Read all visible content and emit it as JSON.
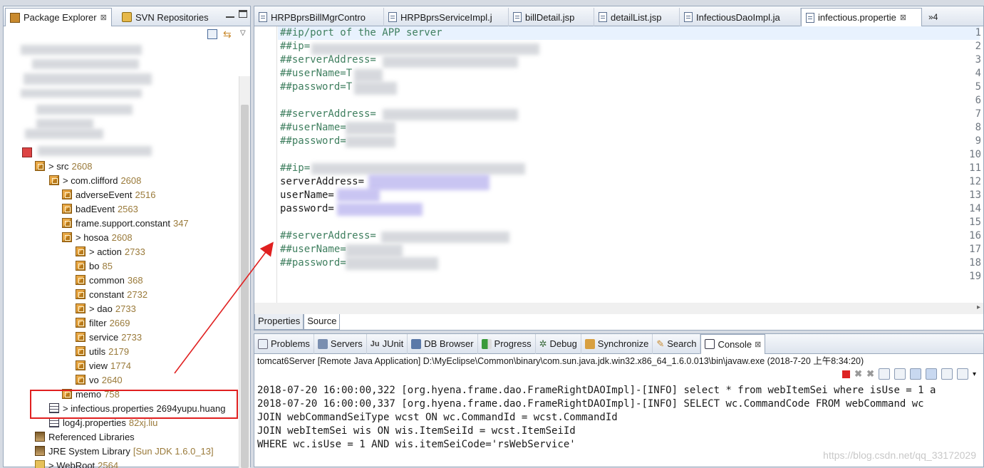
{
  "left_panel": {
    "tabs": [
      {
        "label": "Package Explorer",
        "close": "⊠"
      },
      {
        "label": "SVN Repositories"
      }
    ],
    "tree": [
      {
        "label": "> src",
        "count": "2608"
      },
      {
        "label": "> com.clifford",
        "count": "2608"
      },
      {
        "label": "adverseEvent",
        "count": "2516"
      },
      {
        "label": "badEvent",
        "count": "2563"
      },
      {
        "label": "frame.support.constant",
        "count": "347"
      },
      {
        "label": "> hosoa",
        "count": "2608"
      },
      {
        "label": "> action",
        "count": "2733"
      },
      {
        "label": "bo",
        "count": "85"
      },
      {
        "label": "common",
        "count": "368"
      },
      {
        "label": "constant",
        "count": "2732"
      },
      {
        "label": "> dao",
        "count": "2733"
      },
      {
        "label": "filter",
        "count": "2669"
      },
      {
        "label": "service",
        "count": "2733"
      },
      {
        "label": "utils",
        "count": "2179"
      },
      {
        "label": "view",
        "count": "1774"
      },
      {
        "label": "vo",
        "count": "2640"
      },
      {
        "label": "memo",
        "count": "758"
      },
      {
        "label": "> infectious.properties",
        "count": "2694yupu.huang"
      },
      {
        "label": "log4j.properties",
        "count": "82xj.liu"
      },
      {
        "label": "Referenced Libraries",
        "count": ""
      },
      {
        "label": "JRE System Library",
        "count": "[Sun JDK 1.6.0_13]"
      },
      {
        "label": "> WebRoot",
        "count": "2564"
      }
    ]
  },
  "editor": {
    "tabs": [
      {
        "label": "HRPBprsBillMgrContro"
      },
      {
        "label": "HRPBprsServiceImpl.j"
      },
      {
        "label": "billDetail.jsp"
      },
      {
        "label": "detailList.jsp"
      },
      {
        "label": "InfectiousDaoImpl.ja"
      },
      {
        "label": "infectious.propertie",
        "close": "⊠"
      }
    ],
    "overflow": "»4",
    "lines": [
      {
        "n": "1",
        "text": "##ip/port of the APP server",
        "kind": "cm"
      },
      {
        "n": "2",
        "text": "##ip=",
        "kind": "cm"
      },
      {
        "n": "3",
        "text": "##serverAddress=",
        "kind": "cm"
      },
      {
        "n": "4",
        "text": "##userName=T",
        "kind": "cm"
      },
      {
        "n": "5",
        "text": "##password=T",
        "kind": "cm"
      },
      {
        "n": "6",
        "text": "",
        "kind": "cm"
      },
      {
        "n": "7",
        "text": "##serverAddress=",
        "kind": "cm"
      },
      {
        "n": "8",
        "text": "##userName=",
        "kind": "cm"
      },
      {
        "n": "9",
        "text": "##password=",
        "kind": "cm"
      },
      {
        "n": "10",
        "text": "",
        "kind": "cm"
      },
      {
        "n": "11",
        "text": "##ip=",
        "kind": "cm"
      },
      {
        "n": "12",
        "text": "serverAddress=",
        "kind": "kv"
      },
      {
        "n": "13",
        "text": "userName=",
        "kind": "kv"
      },
      {
        "n": "14",
        "text": "password=",
        "kind": "kv"
      },
      {
        "n": "15",
        "text": "",
        "kind": "cm"
      },
      {
        "n": "16",
        "text": "##serverAddress=",
        "kind": "cm"
      },
      {
        "n": "17",
        "text": "##userName=",
        "kind": "cm"
      },
      {
        "n": "18",
        "text": "##password=",
        "kind": "cm"
      },
      {
        "n": "19",
        "text": "",
        "kind": "cm"
      }
    ],
    "subtabs": [
      "Properties",
      "Source"
    ]
  },
  "console": {
    "tabs": [
      "Problems",
      "Servers",
      "JUnit",
      "DB Browser",
      "Progress",
      "Debug",
      "Synchronize",
      "Search",
      "Console"
    ],
    "header": "tomcat6Server [Remote Java Application] D:\\MyEclipse\\Common\\binary\\com.sun.java.jdk.win32.x86_64_1.6.0.013\\bin\\javaw.exe (2018-7-20 上午8:34:20)",
    "lines": [
      "2018-07-20 16:00:00,322 [org.hyena.frame.dao.FrameRightDAOImpl]-[INFO] select * from webItemSei where isUse = 1 a",
      "2018-07-20 16:00:00,337 [org.hyena.frame.dao.FrameRightDAOImpl]-[INFO] SELECT wc.CommandCode FROM webCommand wc",
      "JOIN webCommandSeiType wcst ON wc.CommandId = wcst.CommandId",
      "JOIN webItemSei wis ON wis.ItemSeiId = wcst.ItemSeiId",
      "WHERE wc.isUse = 1 AND wis.itemSeiCode='rsWebService'"
    ],
    "watermark": "https://blog.csdn.net/qq_33172029"
  },
  "colors": {
    "comment": "#3f7f5f",
    "highlight": "#e02020",
    "count": "#9a7a3a"
  }
}
